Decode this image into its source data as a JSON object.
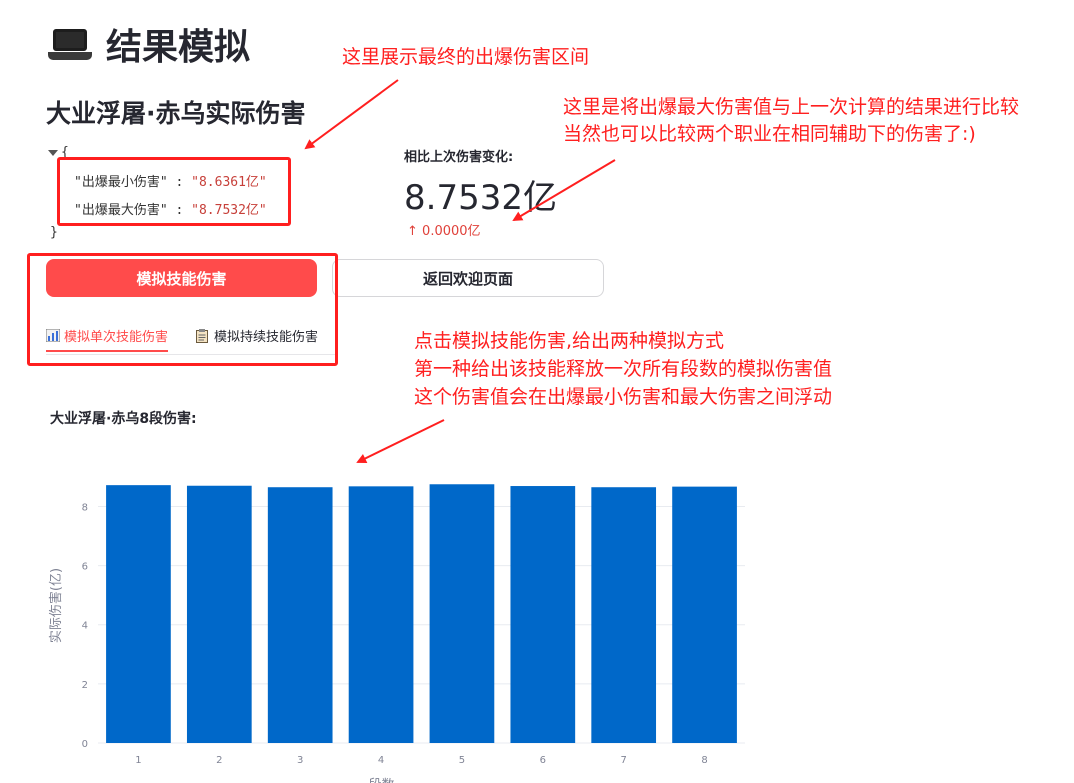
{
  "page": {
    "title": "结果模拟",
    "title_icon": "laptop-icon",
    "subheader": "大业浮屠·赤乌实际伤害"
  },
  "json_view": {
    "open_brace": "{",
    "close_brace": "}",
    "rows": [
      {
        "key": "\"出爆最小伤害\"",
        "sep": " : ",
        "value": "\"8.6361亿\""
      },
      {
        "key": "\"出爆最大伤害\"",
        "sep": " : ",
        "value": "\"8.7532亿\""
      }
    ]
  },
  "metric": {
    "label": "相比上次伤害变化:",
    "value": "8.7532亿",
    "delta": "0.0000亿",
    "delta_icon": "arrow-up-icon",
    "delta_color": "#e0413a"
  },
  "buttons": {
    "simulate": "模拟技能伤害",
    "back": "返回欢迎页面",
    "primary_color": "#ff4b4b"
  },
  "tabs": [
    {
      "label": "模拟单次技能伤害",
      "icon": "bar-chart-icon",
      "active": true
    },
    {
      "label": "模拟持续技能伤害",
      "icon": "clipboard-icon",
      "active": false
    }
  ],
  "chart_heading": "大业浮屠·赤乌8段伤害:",
  "annotations": {
    "a1": "这里展示最终的出爆伤害区间",
    "a2_line1": "这里是将出爆最大伤害值与上一次计算的结果进行比较",
    "a2_line2": "当然也可以比较两个职业在相同辅助下的伤害了:)",
    "a3_line1": "点击模拟技能伤害,给出两种模拟方式",
    "a3_line2": "第一种给出该技能释放一次所有段数的模拟伤害值",
    "a3_line3": "这个伤害值会在出爆最小伤害和最大伤害之间浮动",
    "color": "#ff1f1f"
  },
  "chart_data": {
    "type": "bar",
    "categories": [
      "1",
      "2",
      "3",
      "4",
      "5",
      "6",
      "7",
      "8"
    ],
    "values": [
      8.72,
      8.7,
      8.65,
      8.68,
      8.75,
      8.69,
      8.65,
      8.67
    ],
    "xlabel": "段数",
    "ylabel": "实际伤害(亿)",
    "ylim": [
      0,
      9.3
    ],
    "yticks": [
      0,
      2,
      4,
      6,
      8
    ],
    "bar_color": "#0068c9",
    "grid": true
  }
}
